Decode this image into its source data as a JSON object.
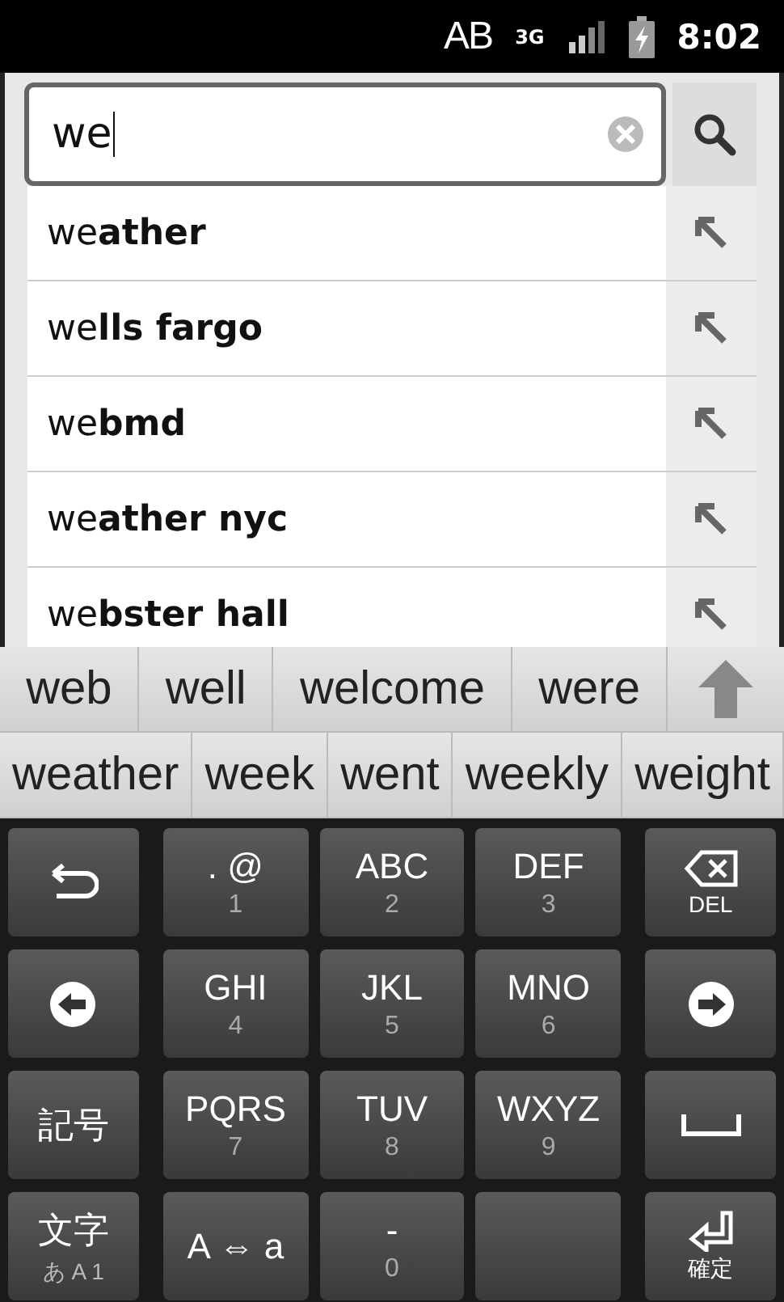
{
  "status_bar": {
    "network_label": "AB",
    "data_label": "3G",
    "time": "8:02"
  },
  "search": {
    "value": "we"
  },
  "suggestions": [
    {
      "text": "we**ather**"
    },
    {
      "text": "we**lls fargo**"
    },
    {
      "text": "we**bmd**"
    },
    {
      "text": "we**ather nyc**"
    },
    {
      "text": "we**bster hall**"
    }
  ],
  "candidates": [
    [
      {
        "text": "web"
      },
      {
        "text": "well"
      },
      {
        "text": "welcome"
      },
      {
        "text": "were"
      }
    ],
    [
      {
        "text": "weather"
      },
      {
        "text": "week"
      },
      {
        "text": "went"
      },
      {
        "text": "weekly"
      },
      {
        "text": "weight"
      }
    ]
  ],
  "keyboard": [
    [
      {
        "kind": "back"
      },
      {
        "kind": "letters",
        "label": ". @",
        "digit": "1"
      },
      {
        "kind": "letters",
        "label": "ABC",
        "digit": "2"
      },
      {
        "kind": "letters",
        "label": "DEF",
        "digit": "3"
      },
      {
        "kind": "delete",
        "label": "DEL"
      }
    ],
    [
      {
        "kind": "left"
      },
      {
        "kind": "letters",
        "label": "GHI",
        "digit": "4"
      },
      {
        "kind": "letters",
        "label": "JKL",
        "digit": "5"
      },
      {
        "kind": "letters",
        "label": "MNO",
        "digit": "6"
      },
      {
        "kind": "right"
      }
    ],
    [
      {
        "kind": "text",
        "label": "記号"
      },
      {
        "kind": "letters",
        "label": "PQRS",
        "digit": "7"
      },
      {
        "kind": "letters",
        "label": "TUV",
        "digit": "8"
      },
      {
        "kind": "letters",
        "label": "WXYZ",
        "digit": "9"
      },
      {
        "kind": "space"
      }
    ],
    [
      {
        "kind": "text",
        "label": "文字",
        "sub": "あ A 1"
      },
      {
        "kind": "text",
        "label": "A ⇔ a"
      },
      {
        "kind": "letters",
        "label": "-",
        "digit": "0"
      },
      {
        "kind": "blank"
      },
      {
        "kind": "enter",
        "label": "確定"
      }
    ]
  ]
}
